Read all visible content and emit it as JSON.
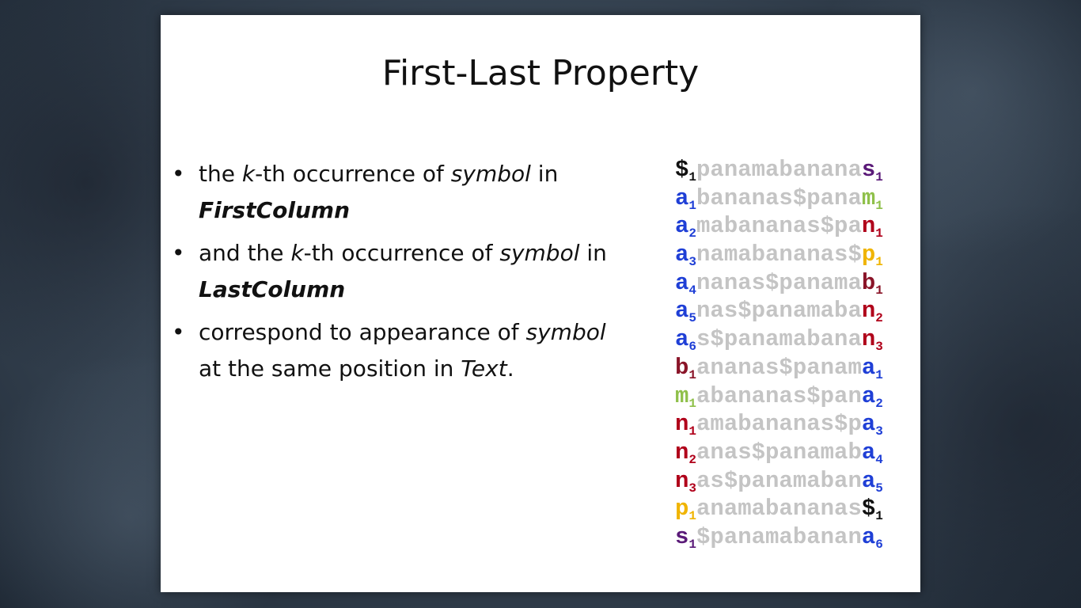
{
  "title": "First-Last Property",
  "bullets": [
    {
      "parts": [
        "the ",
        "k",
        "-th occurrence of ",
        "symbol",
        " in"
      ],
      "line2": "FirstColumn"
    },
    {
      "parts": [
        "and the ",
        "k",
        "-th occurrence of ",
        "symbol",
        " in"
      ],
      "line2": "LastColumn"
    },
    {
      "parts": [
        "correspond to appearance of ",
        "symbol"
      ],
      "line2a": "at the same position in ",
      "line2b": "Text",
      "line2c": "."
    }
  ],
  "bullet_char": "•",
  "colors": {
    "$": "#111111",
    "a": "#1f3fd6",
    "b": "#8a1428",
    "m": "#8fc04a",
    "n": "#b0001a",
    "p": "#f0b400",
    "s": "#5a1a78",
    "middle": "#c4c4c4"
  },
  "matrix": [
    {
      "first": "$",
      "fi": "1",
      "middle": "panamabanana",
      "last": "s",
      "li": "1"
    },
    {
      "first": "a",
      "fi": "1",
      "middle": "bananas$pana",
      "last": "m",
      "li": "1"
    },
    {
      "first": "a",
      "fi": "2",
      "middle": "mabananas$pa",
      "last": "n",
      "li": "1"
    },
    {
      "first": "a",
      "fi": "3",
      "middle": "namabananas$",
      "last": "p",
      "li": "1"
    },
    {
      "first": "a",
      "fi": "4",
      "middle": "nanas$panama",
      "last": "b",
      "li": "1"
    },
    {
      "first": "a",
      "fi": "5",
      "middle": "nas$panamaba",
      "last": "n",
      "li": "2"
    },
    {
      "first": "a",
      "fi": "6",
      "middle": "s$panamabana",
      "last": "n",
      "li": "3"
    },
    {
      "first": "b",
      "fi": "1",
      "middle": "ananas$panam",
      "last": "a",
      "li": "1"
    },
    {
      "first": "m",
      "fi": "1",
      "middle": "abananas$pan",
      "last": "a",
      "li": "2"
    },
    {
      "first": "n",
      "fi": "1",
      "middle": "amabananas$p",
      "last": "a",
      "li": "3"
    },
    {
      "first": "n",
      "fi": "2",
      "middle": "anas$panamab",
      "last": "a",
      "li": "4"
    },
    {
      "first": "n",
      "fi": "3",
      "middle": "as$panamaban",
      "last": "a",
      "li": "5"
    },
    {
      "first": "p",
      "fi": "1",
      "middle": "anamabananas",
      "last": "$",
      "li": "1"
    },
    {
      "first": "s",
      "fi": "1",
      "middle": "$panamabanan",
      "last": "a",
      "li": "6"
    }
  ]
}
